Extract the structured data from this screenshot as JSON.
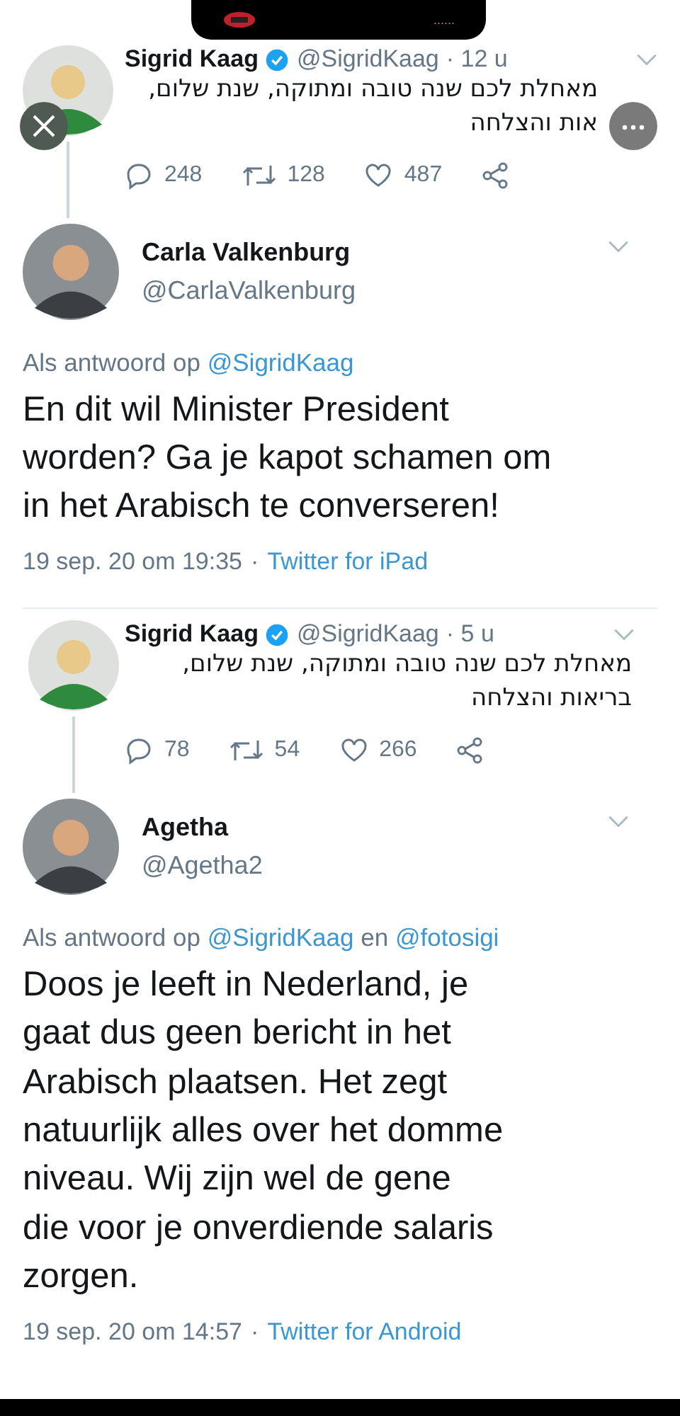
{
  "status_overlay": {
    "text": "......"
  },
  "tweets": [
    {
      "kind": "compact",
      "name": "Sigrid Kaag",
      "verified": true,
      "handle": "@SigridKaag",
      "time": "· 12 u",
      "text": "מאחלת לכם שנה טובה ומתוקה, שנת שלום,\nאות והצלחה",
      "close_overlay": true,
      "more_overlay": true,
      "separator": false,
      "stats": {
        "replies": "248",
        "retweets": "128",
        "likes": "487"
      }
    },
    {
      "kind": "main",
      "name": "Carla Valkenburg",
      "handle": "@CarlaValkenburg",
      "reply_to": [
        {
          "kind": "plain",
          "text": "Als antwoord op"
        },
        {
          "kind": "mention",
          "text": "@SigridKaag"
        }
      ],
      "text": "En dit wil Minister President\nworden? Ga je kapot schamen om\nin het Arabisch te converseren!",
      "date": "19 sep. 20 om 19:35",
      "dot": "·",
      "source": "Twitter for iPad"
    },
    {
      "kind": "compact",
      "name": "Sigrid Kaag",
      "verified": true,
      "handle": "@SigridKaag",
      "time": "· 5 u",
      "text": "מאחלת לכם שנה טובה ומתוקה, שנת שלום,\nבריאות והצלחה",
      "close_overlay": false,
      "more_overlay": false,
      "separator": true,
      "stats": {
        "replies": "78",
        "retweets": "54",
        "likes": "266"
      }
    },
    {
      "kind": "main",
      "name": "Agetha",
      "handle": "@Agetha2",
      "reply_to": [
        {
          "kind": "plain",
          "text": "Als antwoord op"
        },
        {
          "kind": "mention",
          "text": "@SigridKaag"
        },
        {
          "kind": "plain",
          "text": "en"
        },
        {
          "kind": "mention",
          "text": "@fotosigi"
        }
      ],
      "text": "Doos je leeft in Nederland, je\ngaat dus geen bericht in het\nArabisch plaatsen. Het zegt\nnatuurlijk alles over het domme\nniveau. Wij zijn wel de gene\ndie voor je onverdiende salaris\nzorgen.",
      "date": "19 sep. 20 om 14:57",
      "dot": "·",
      "source": "Twitter for Android"
    }
  ]
}
